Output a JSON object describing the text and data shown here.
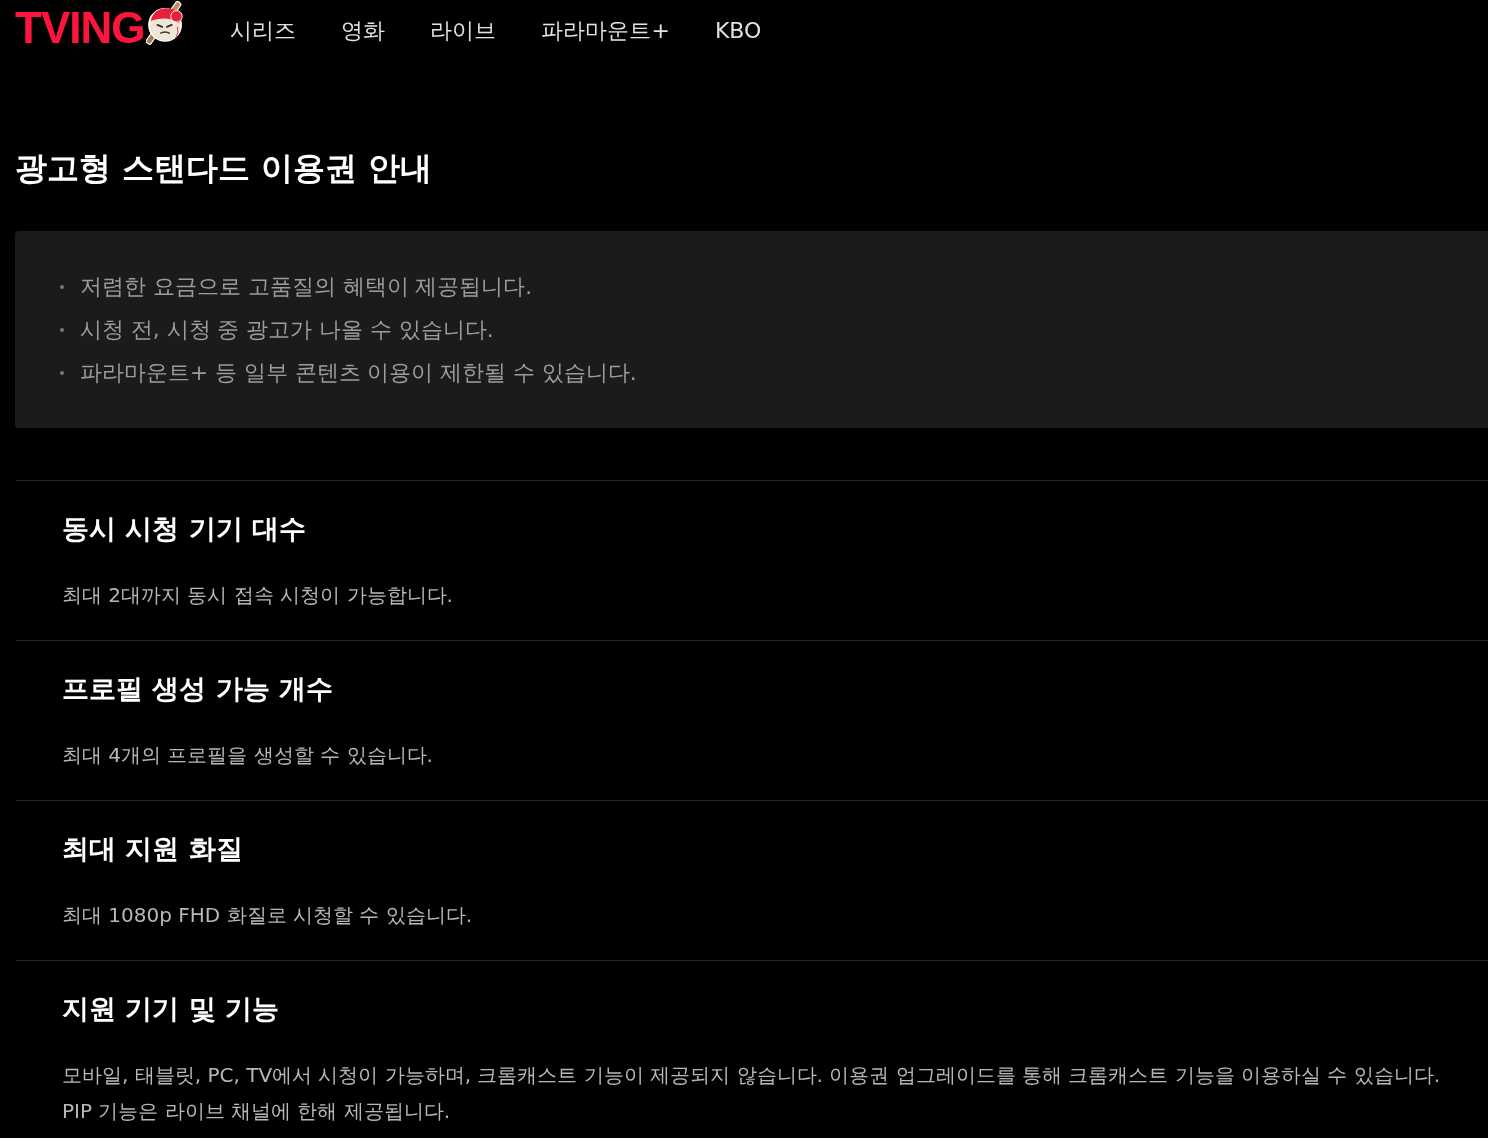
{
  "header": {
    "logo": "TVING",
    "nav": [
      "시리즈",
      "영화",
      "라이브",
      "파라마운트+",
      "KBO"
    ]
  },
  "page_title": "광고형 스탠다드 이용권 안내",
  "notice": {
    "items": [
      "저렴한 요금으로 고품질의 혜택이 제공됩니다.",
      "시청 전, 시청 중 광고가 나올 수 있습니다.",
      "파라마운트+ 등 일부 콘텐츠 이용이 제한될 수 있습니다."
    ]
  },
  "sections": [
    {
      "heading": "동시 시청 기기 대수",
      "description": "최대 2대까지 동시 접속 시청이 가능합니다."
    },
    {
      "heading": "프로필 생성 가능 개수",
      "description": "최대 4개의 프로필을 생성할 수 있습니다."
    },
    {
      "heading": "최대 지원 화질",
      "description": "최대 1080p FHD 화질로 시청할 수 있습니다."
    },
    {
      "heading": "지원 기기 및 기능",
      "description": "모바일, 태블릿, PC, TV에서 시청이 가능하며, 크롬캐스트 기능이 제공되지 않습니다. 이용권 업그레이드를 통해 크롬캐스트 기능을 이용하실 수 있습니다. PIP 기능은 라이브 채널에 한해 제공됩니다."
    }
  ]
}
